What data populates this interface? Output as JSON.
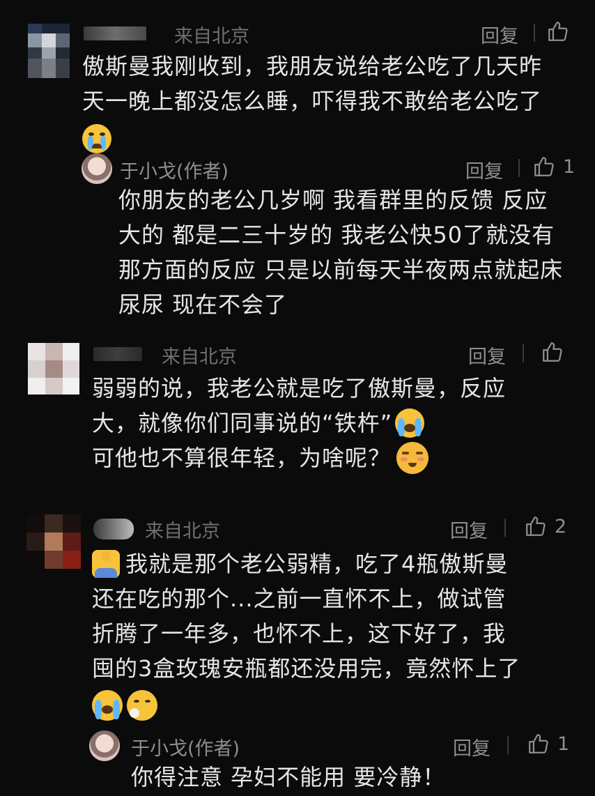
{
  "comments": [
    {
      "location": "来自北京",
      "reply_label": "回复",
      "like_count": "",
      "lines": [
        "傲斯曼我刚收到，我朋友说给老公吃了几天昨",
        "天一晚上都没怎么睡，吓得我不敢给老公吃了"
      ],
      "emoji": "crying-face",
      "author_reply": {
        "name": "于小戈(作者)",
        "reply_label": "回复",
        "like_count": "1",
        "lines": [
          "你朋友的老公几岁啊 我看群里的反馈 反应",
          "大的 都是二三十岁的 我老公快50了就没有",
          "那方面的反应 只是以前每天半夜两点就起床",
          "尿尿 现在不会了"
        ]
      }
    },
    {
      "location": "来自北京",
      "reply_label": "回复",
      "like_count": "",
      "lines": [
        "弱弱的说，我老公就是吃了傲斯曼，反应",
        "大，就像你们同事说的“铁杵”",
        "可他也不算很年轻，为啥呢？"
      ],
      "emojis": [
        "loudly-crying-face",
        "blushing-face"
      ]
    },
    {
      "location": "来自北京",
      "reply_label": "回复",
      "like_count": "2",
      "lines": [
        "我就是那个老公弱精，吃了4瓶傲斯曼",
        "还在吃的那个...之前一直怀不上，做试管",
        "折腾了一年多，也怀不上，这下好了，我",
        "囤的3盒玫瑰安瓶都还没用完，竟然怀上了"
      ],
      "emojis": [
        "person-raising-hand",
        "loudly-crying-face",
        "face-exhaling"
      ],
      "author_reply": {
        "name": "于小戈(作者)",
        "reply_label": "回复",
        "like_count": "1",
        "lines": [
          "你得注意 孕妇不能用 要冷静！"
        ]
      }
    }
  ],
  "colors": {
    "background": "#0b0b0c",
    "text": "#e6e6e6",
    "muted": "#8e8e93",
    "location": "#6f6f73",
    "emoji_yellow": "#f6c33a",
    "tear_blue": "#5fb7ff"
  }
}
